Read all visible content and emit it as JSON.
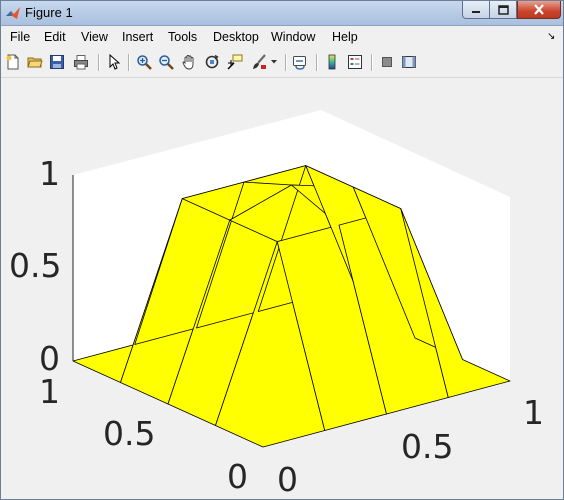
{
  "window": {
    "title": "Figure 1"
  },
  "menu": {
    "items": [
      "File",
      "Edit",
      "View",
      "Insert",
      "Tools",
      "Desktop",
      "Window",
      "Help"
    ]
  },
  "toolbar": {
    "buttons": [
      "new-figure-icon",
      "open-file-icon",
      "save-icon",
      "print-icon",
      "select-arrow-icon",
      "zoom-in-icon",
      "zoom-out-icon",
      "pan-hand-icon",
      "rotate-3d-icon",
      "data-cursor-icon",
      "brush-icon",
      "link-plot-icon",
      "colorbar-icon",
      "legend-icon",
      "hide-plot-tools-icon",
      "show-plot-tools-icon"
    ]
  },
  "colors": {
    "surface_face": "#ffff00",
    "surface_edge": "#000000",
    "axes_background": "#ffffff",
    "figure_background": "#f0f0f0"
  },
  "chart_data": {
    "type": "surface",
    "description_shape": "pyramid",
    "x": [
      0,
      0.25,
      0.5,
      0.75,
      1
    ],
    "y": [
      0,
      0.25,
      0.5,
      0.75,
      1
    ],
    "z": [
      [
        0,
        0,
        0,
        0,
        0
      ],
      [
        0,
        0.9,
        0.9,
        0.9,
        0
      ],
      [
        0,
        0.9,
        1,
        0.9,
        0
      ],
      [
        0,
        0.9,
        0.9,
        0.9,
        0
      ],
      [
        0,
        0,
        0,
        0,
        0
      ]
    ],
    "zlim": [
      0,
      1
    ],
    "xlim": [
      0,
      1
    ],
    "ylim": [
      0,
      1
    ],
    "x_ticks": [
      "0",
      "0.5",
      "1"
    ],
    "y_ticks": [
      "0",
      "0.5",
      "1"
    ],
    "z_ticks": [
      "0",
      "0.5",
      "1"
    ],
    "face_color": "#ffff00",
    "grid": false
  }
}
